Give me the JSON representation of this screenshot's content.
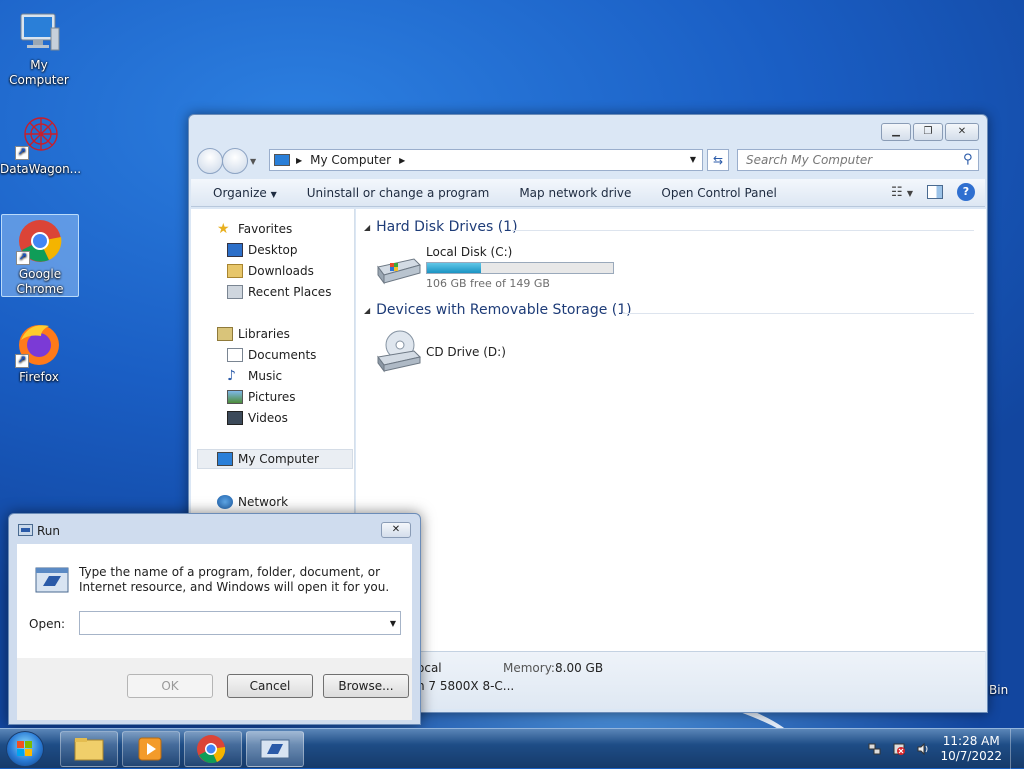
{
  "desktop": {
    "icons": [
      {
        "label": "My Computer"
      },
      {
        "label": "DataWagon..."
      },
      {
        "label": "Google Chrome"
      },
      {
        "label": "Firefox"
      }
    ],
    "partial_label": "Bin"
  },
  "explorer": {
    "address": "My Computer",
    "search_placeholder": "Search My Computer",
    "toolbar": {
      "organize": "Organize",
      "uninstall": "Uninstall or change a program",
      "map_drive": "Map network drive",
      "control_panel": "Open Control Panel"
    },
    "nav": {
      "favorites": "Favorites",
      "desktop": "Desktop",
      "downloads": "Downloads",
      "recent": "Recent Places",
      "libraries": "Libraries",
      "documents": "Documents",
      "music": "Music",
      "pictures": "Pictures",
      "videos": "Videos",
      "my_computer": "My Computer",
      "network": "Network"
    },
    "groups": {
      "hdd": "Hard Disk Drives (1)",
      "removable": "Devices with Removable Storage (1)"
    },
    "drives": {
      "c_name": "Local Disk (C:)",
      "c_free": "106 GB free of 149 GB",
      "c_used_fraction": 0.29,
      "d_name": "CD Drive (D:)"
    },
    "details": {
      "workgroup_partial": "ocal",
      "memory_label": "Memory:",
      "memory_value": "8.00 GB",
      "processor_partial": "n 7 5800X 8-C..."
    }
  },
  "run_dialog": {
    "title": "Run",
    "message": "Type the name of a program, folder, document, or Internet resource, and Windows will open it for you.",
    "open_label": "Open:",
    "open_value": "",
    "ok": "OK",
    "cancel": "Cancel",
    "browse": "Browse..."
  },
  "taskbar": {
    "time": "11:28 AM",
    "date": "10/7/2022"
  }
}
